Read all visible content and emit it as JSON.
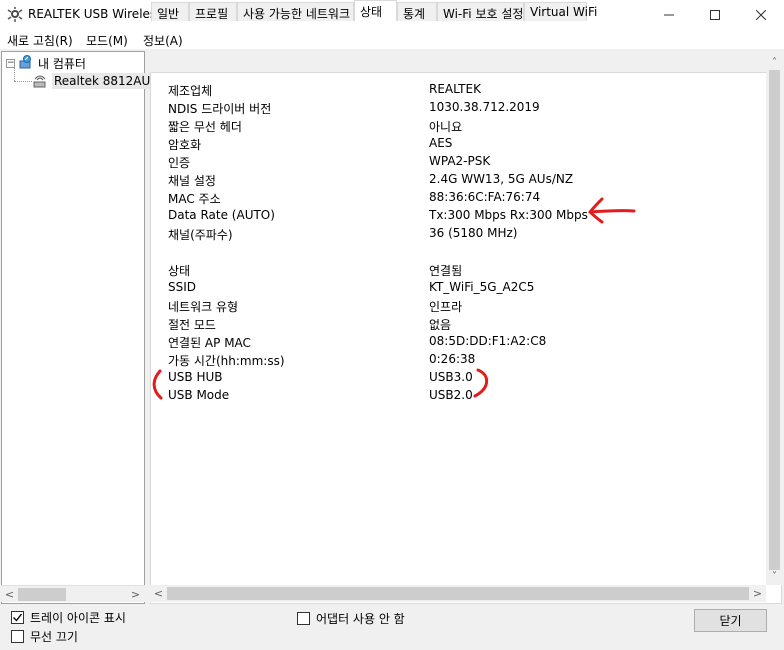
{
  "window": {
    "title": "REALTEK USB Wireless LAN Utility"
  },
  "menu": [
    "새로 고침(R)",
    "모드(M)",
    "정보(A)"
  ],
  "tree": {
    "root": "내 컴퓨터",
    "child": "Realtek 8812AU"
  },
  "tabs": [
    "일반",
    "프로필",
    "사용 가능한 네트워크",
    "상태",
    "통계",
    "Wi-Fi 보호 설정",
    "Virtual WiFi"
  ],
  "active_tab": "상태",
  "status_group1": [
    {
      "label": "제조업체",
      "value": "REALTEK"
    },
    {
      "label": "NDIS 드라이버 버전",
      "value": "1030.38.712.2019"
    },
    {
      "label": "짧은 무선 헤더",
      "value": "아니요"
    },
    {
      "label": "암호화",
      "value": "AES"
    },
    {
      "label": "인증",
      "value": "WPA2-PSK"
    },
    {
      "label": "채널 설정",
      "value": "2.4G WW13, 5G AUs/NZ"
    },
    {
      "label": "MAC 주소",
      "value": "88:36:6C:FA:76:74"
    },
    {
      "label": "Data Rate (AUTO)",
      "value": "Tx:300 Mbps Rx:300 Mbps"
    },
    {
      "label": "채널(주파수)",
      "value": "36 (5180 MHz)"
    }
  ],
  "status_group2": [
    {
      "label": "상태",
      "value": "연결됨"
    },
    {
      "label": "SSID",
      "value": "KT_WiFi_5G_A2C5"
    },
    {
      "label": "네트워크 유형",
      "value": "인프라"
    },
    {
      "label": "절전 모드",
      "value": "없음"
    },
    {
      "label": "연결된 AP MAC",
      "value": "08:5D:DD:F1:A2:C8"
    },
    {
      "label": "가동 시간(hh:mm:ss)",
      "value": "0:26:38"
    },
    {
      "label": "USB HUB",
      "value": "USB3.0"
    },
    {
      "label": "USB Mode",
      "value": "USB2.0"
    }
  ],
  "footer": {
    "tray_icon_label": "트레이 아이콘 표시",
    "tray_icon_checked": true,
    "radio_off_label": "무선 끄기",
    "radio_off_checked": false,
    "disable_adapter_label": "어댑터 사용 안 함",
    "disable_adapter_checked": false,
    "close_label": "닫기"
  },
  "colors": {
    "annotation_red": "#e31b1b",
    "content_bg": "#ffffff",
    "window_bg": "#f0f0f0"
  }
}
